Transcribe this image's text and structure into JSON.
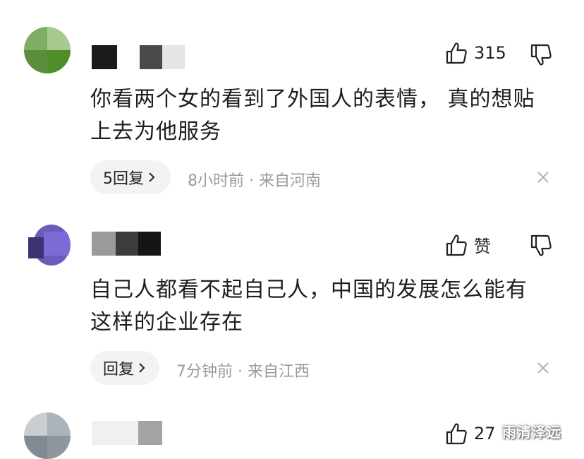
{
  "comments": [
    {
      "likes": "315",
      "text_line1": "你看两个女的看到了外国人的表情， 真的想贴",
      "text_line2": "上去为他服务",
      "reply_label": "5回复",
      "time": "8小时前",
      "separator": "·",
      "location": "来自河南"
    },
    {
      "likes": "赞",
      "text_line1": "自己人都看不起自己人，中国的发展怎么能有",
      "text_line2": "这样的企业存在",
      "reply_label": "回复",
      "time": "7分钟前",
      "separator": "·",
      "location": "来自江西"
    },
    {
      "likes": "27"
    }
  ],
  "watermark": "雨清泽远",
  "icons": [
    "thumbs-up-icon",
    "thumbs-down-icon",
    "chevron-right-icon",
    "close-icon"
  ]
}
